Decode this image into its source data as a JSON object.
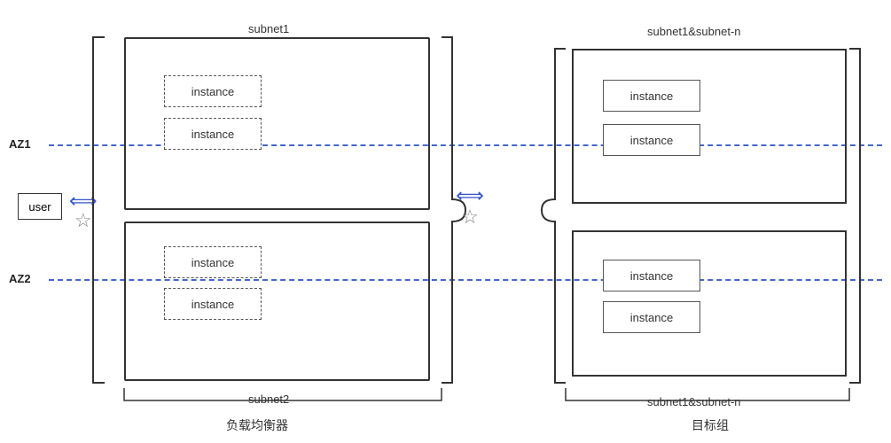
{
  "labels": {
    "az1": "AZ1",
    "az2": "AZ2",
    "user": "user",
    "subnet1": "subnet1",
    "subnet2": "subnet2",
    "subnet1n_top": "subnet1&subnet-n",
    "subnet1n_bottom": "subnet1&subnet-n",
    "lbe": "负载均衡器",
    "target": "目标组",
    "instance": "instance"
  }
}
